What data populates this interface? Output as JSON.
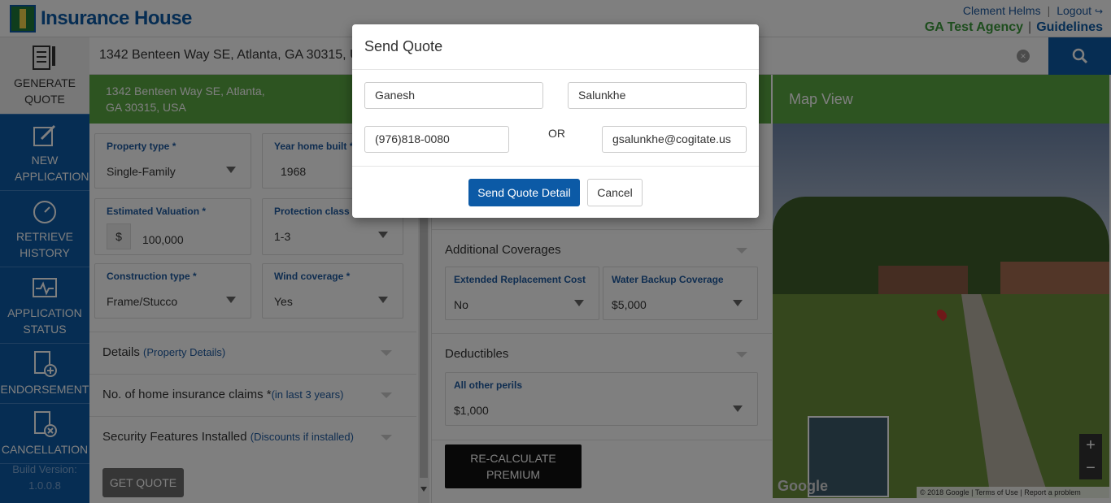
{
  "header": {
    "logo_text": "Insurance House",
    "user_name": "Clement Helms",
    "logout_label": "Logout",
    "agency_name": "GA Test Agency",
    "guidelines_label": "Guidelines"
  },
  "sidebar": {
    "items": [
      {
        "label": "GENERATE QUOTE",
        "icon": "document-pen-icon",
        "active": true
      },
      {
        "label": "NEW APPLICATION",
        "icon": "edit-icon"
      },
      {
        "label": "RETRIEVE HISTORY",
        "icon": "history-icon"
      },
      {
        "label": "APPLICATION STATUS",
        "icon": "pulse-icon"
      },
      {
        "label": "ENDORSEMENT",
        "icon": "document-plus-icon"
      },
      {
        "label": "CANCELLATION",
        "icon": "document-cancel-icon"
      }
    ],
    "build_label": "Build Version:",
    "build_version": "1.0.0.8"
  },
  "search": {
    "value": "1342 Benteen Way SE, Atlanta, GA 30315, USA"
  },
  "address_strip": {
    "line1": "1342 Benteen Way SE, Atlanta,",
    "line2": "GA 30315, USA"
  },
  "map": {
    "title": "Map View",
    "attribution": "© 2018 Google  |  Terms of Use  |  Report a problem",
    "google_label": "Google",
    "zoom_in": "+",
    "zoom_out": "−"
  },
  "form": {
    "property_type": {
      "label": "Property type *",
      "value": "Single-Family"
    },
    "year_built": {
      "label": "Year home built *",
      "value": "1968"
    },
    "estimated_valuation": {
      "label": "Estimated Valuation *",
      "currency": "$",
      "value": "100,000"
    },
    "protection_class": {
      "label": "Protection class *",
      "value": "1-3"
    },
    "construction_type": {
      "label": "Construction type *",
      "value": "Frame/Stucco"
    },
    "wind_coverage": {
      "label": "Wind coverage *",
      "value": "Yes"
    },
    "details": {
      "title": "Details",
      "sub": "(Property Details)"
    },
    "claims": {
      "title": "No. of home insurance claims *",
      "sub": "(in last 3 years)"
    },
    "security": {
      "title": "Security Features Installed",
      "sub": "(Discounts if installed)"
    },
    "get_quote_label": "GET QUOTE"
  },
  "coverages": {
    "additional_title": "Additional Coverages",
    "extended_replacement": {
      "label": "Extended Replacement Cost",
      "value": "No"
    },
    "water_backup": {
      "label": "Water Backup Coverage",
      "value": "$5,000"
    },
    "deductibles_title": "Deductibles",
    "all_other_perils": {
      "label": "All other perils",
      "value": "$1,000"
    },
    "recalc_line1": "RE-CALCULATE",
    "recalc_line2": "PREMIUM"
  },
  "modal": {
    "title": "Send Quote",
    "first_name": "Ganesh",
    "last_name": "Salunkhe",
    "phone": "(976)818-0080",
    "or_label": "OR",
    "email": "gsalunkhe@cogitate.us",
    "send_label": "Send Quote Detail",
    "cancel_label": "Cancel"
  },
  "colors": {
    "primary": "#0c5aa6",
    "green": "#5aa843",
    "agency_green": "#3a9a3a"
  }
}
